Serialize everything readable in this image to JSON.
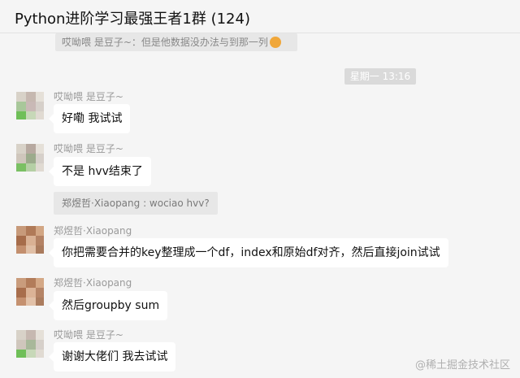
{
  "header": {
    "title": "Python进阶学习最强王者1群 (124)"
  },
  "top_quote": {
    "text": "哎呦喂   是豆子~：但是他数据没办法与到那一列"
  },
  "timestamp": "星期一 13:16",
  "messages": [
    {
      "sender": "哎呦喂   是豆子~",
      "text": "好嘞  我试试",
      "avatar_colors": [
        "#d8d2c8",
        "#c6b8b0",
        "#e5e0d8",
        "#a8c79a",
        "#c9b9b6",
        "#d6d0ca",
        "#6fbf58",
        "#c7d8b8",
        "#e0dad2"
      ]
    },
    {
      "sender": "哎呦喂   是豆子~",
      "text": "不是 hvv结束了",
      "avatar_colors": [
        "#d8d2c8",
        "#b7a9a0",
        "#e5e0d8",
        "#cfc6bc",
        "#9cab8c",
        "#d6d0ca",
        "#7ac063",
        "#b5cfa5",
        "#e0dad2"
      ]
    },
    {
      "quote": "郑煜哲·Xiaopang : wociao hvv?"
    },
    {
      "sender": "郑煜哲·Xiaopang",
      "text": "你把需要合并的key整理成一个df，index和原始df对齐，然后直接join试试",
      "avatar_colors": [
        "#c79a7a",
        "#b07a58",
        "#d2a684",
        "#a66c4a",
        "#d9b194",
        "#b38264",
        "#c38f6e",
        "#e0bfa6",
        "#a97a5c"
      ]
    },
    {
      "sender": "郑煜哲·Xiaopang",
      "text": "然后groupby sum",
      "avatar_colors": [
        "#c99c7c",
        "#b27c5a",
        "#d4a886",
        "#a86e4c",
        "#dbb396",
        "#b58466",
        "#c59170",
        "#e2c1a8",
        "#ab7c5e"
      ]
    },
    {
      "sender": "哎呦喂   是豆子~",
      "text": "谢谢大佬们  我去试试",
      "avatar_colors": [
        "#d8d2c8",
        "#c6b8b0",
        "#e5e0d8",
        "#cfc6bc",
        "#a8b89a",
        "#d6d0ca",
        "#6fbf58",
        "#c7d8b8",
        "#e0dad2"
      ]
    }
  ],
  "watermark": "@稀土掘金技术社区"
}
